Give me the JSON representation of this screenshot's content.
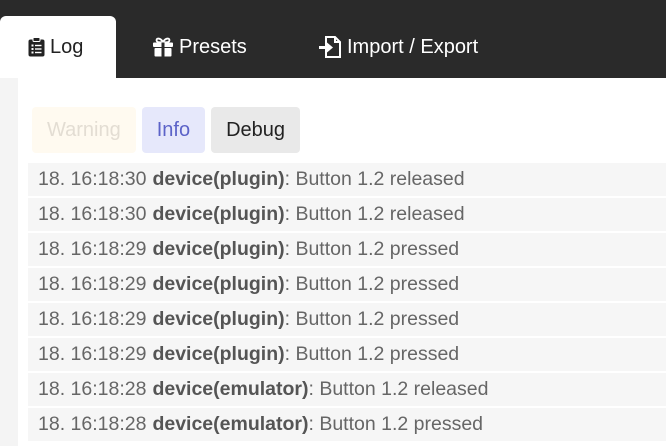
{
  "tabs": [
    {
      "label": "Log",
      "icon": "clipboard-list-icon",
      "active": true
    },
    {
      "label": "Presets",
      "icon": "gift-icon",
      "active": false
    },
    {
      "label": "Import / Export",
      "icon": "file-import-icon",
      "active": false
    }
  ],
  "filters": {
    "warning": "Warning",
    "info": "Info",
    "debug": "Debug"
  },
  "log": [
    {
      "time": "18. 16:18:30",
      "source": "device(plugin)",
      "message": ": Button 1.2 released"
    },
    {
      "time": "18. 16:18:30",
      "source": "device(plugin)",
      "message": ": Button 1.2 released"
    },
    {
      "time": "18. 16:18:29",
      "source": "device(plugin)",
      "message": ": Button 1.2 pressed"
    },
    {
      "time": "18. 16:18:29",
      "source": "device(plugin)",
      "message": ": Button 1.2 pressed"
    },
    {
      "time": "18. 16:18:29",
      "source": "device(plugin)",
      "message": ": Button 1.2 pressed"
    },
    {
      "time": "18. 16:18:29",
      "source": "device(plugin)",
      "message": ": Button 1.2 pressed"
    },
    {
      "time": "18. 16:18:28",
      "source": "device(emulator)",
      "message": ": Button 1.2 released"
    },
    {
      "time": "18. 16:18:28",
      "source": "device(emulator)",
      "message": ": Button 1.2 pressed"
    }
  ],
  "colors": {
    "topbar": "#2a2a2a",
    "info_accent": "#5c63c8",
    "warning_text": "#e3ddd3"
  }
}
